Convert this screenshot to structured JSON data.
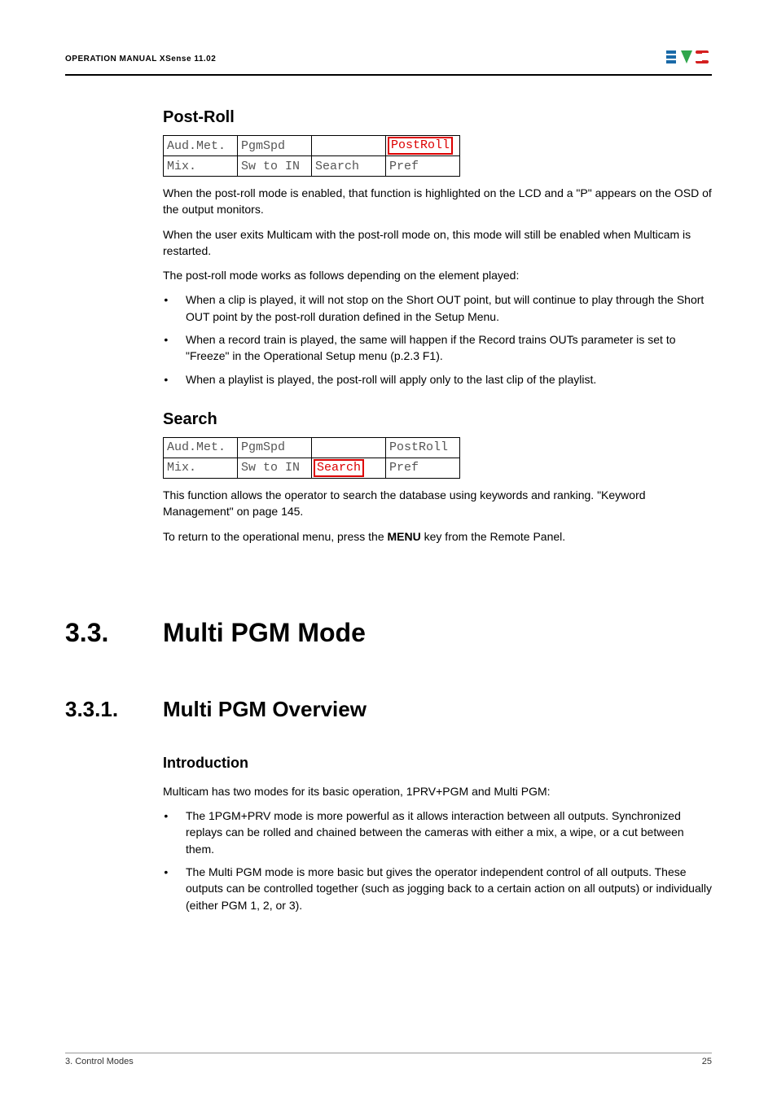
{
  "header": {
    "title": "OPERATION MANUAL XSense 11.02"
  },
  "sections": {
    "postroll": {
      "heading": "Post-Roll",
      "table": {
        "r1c1": "Aud.Met.",
        "r1c2": "PgmSpd",
        "r1c3": "",
        "r1c4": "PostRoll",
        "r2c1": "Mix.",
        "r2c2": "Sw to IN",
        "r2c3": "Search",
        "r2c4": "Pref"
      },
      "p1": "When the post-roll mode is enabled, that function is highlighted on the LCD and a \"P\" appears on the OSD of the output monitors.",
      "p2": "When the user exits Multicam with the post-roll mode on, this mode will still be enabled when Multicam is restarted.",
      "p3": "The post-roll mode works as follows depending on the element played:",
      "bullets": [
        "When a clip is played, it will not stop on the Short OUT point, but will continue to play through the Short OUT point by the post-roll duration defined in the Setup Menu.",
        "When a record train is played, the same will happen if the Record trains OUTs parameter is set to \"Freeze\" in the Operational Setup menu (p.2.3 F1).",
        "When a playlist is played, the post-roll will apply only to the last clip of the playlist."
      ]
    },
    "search": {
      "heading": "Search",
      "table": {
        "r1c1": "Aud.Met.",
        "r1c2": "PgmSpd",
        "r1c3": "",
        "r1c4": "PostRoll",
        "r2c1": "Mix.",
        "r2c2": "Sw to IN",
        "r2c3": "Search",
        "r2c4": "Pref"
      },
      "p1": "This function allows the operator to search the database using keywords and ranking. \"Keyword Management\" on page 145.",
      "p2_pre": "To return to the operational menu, press the ",
      "p2_bold": "MENU",
      "p2_post": " key from the Remote Panel."
    },
    "multipgm": {
      "num": "3.3.",
      "heading": "Multi PGM Mode"
    },
    "overview": {
      "num": "3.3.1.",
      "heading": "Multi PGM Overview",
      "intro_heading": "Introduction",
      "p1": "Multicam has two modes for its basic operation, 1PRV+PGM and Multi PGM:",
      "bullets": [
        "The 1PGM+PRV mode is more powerful as it allows interaction between all outputs. Synchronized replays can be rolled and chained between the cameras with either a mix, a wipe, or a cut between them.",
        "The Multi PGM mode is more basic but gives the operator independent control of all outputs. These outputs can be controlled together (such as jogging back to a certain action on all outputs) or individually (either PGM 1, 2, or 3)."
      ]
    }
  },
  "footer": {
    "left": "3. Control Modes",
    "right": "25"
  }
}
